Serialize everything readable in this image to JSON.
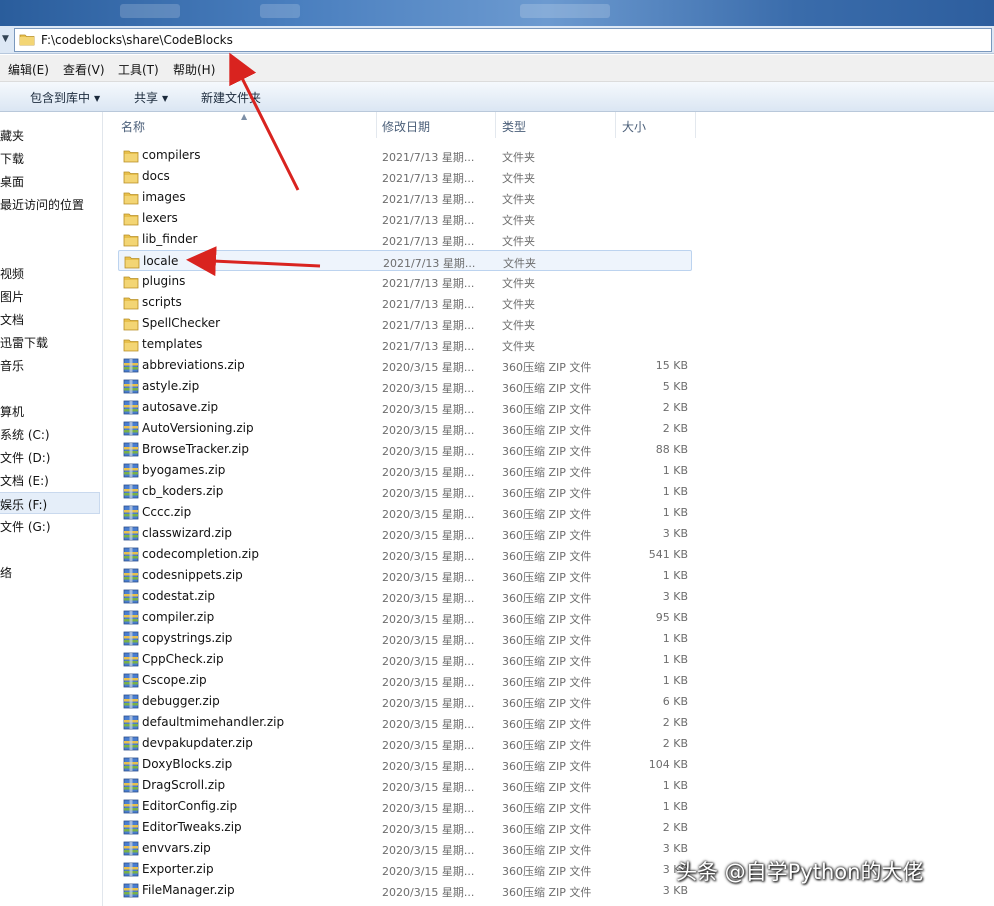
{
  "address": {
    "path": "F:\\codeblocks\\share\\CodeBlocks"
  },
  "menu": [
    "编辑(E)",
    "查看(V)",
    "工具(T)",
    "帮助(H)"
  ],
  "toolbar": {
    "include_label": "包含到库中",
    "share_label": "共享",
    "new_folder_label": "新建文件夹"
  },
  "sidebar": [
    "藏夹",
    "下载",
    "桌面",
    "最近访问的位置",
    "视频",
    "图片",
    "文档",
    "迅雷下载",
    "音乐",
    "算机",
    "系统 (C:)",
    "文件 (D:)",
    "文档 (E:)",
    "娱乐 (F:)",
    "文件 (G:)",
    "络"
  ],
  "columns": {
    "name": "名称",
    "date": "修改日期",
    "type": "类型",
    "size": "大小"
  },
  "files": [
    {
      "name": "compilers",
      "date": "2021/7/13 星期...",
      "type": "文件夹",
      "size": "",
      "icon": "folder-icon"
    },
    {
      "name": "docs",
      "date": "2021/7/13 星期...",
      "type": "文件夹",
      "size": "",
      "icon": "folder-icon"
    },
    {
      "name": "images",
      "date": "2021/7/13 星期...",
      "type": "文件夹",
      "size": "",
      "icon": "folder-icon"
    },
    {
      "name": "lexers",
      "date": "2021/7/13 星期...",
      "type": "文件夹",
      "size": "",
      "icon": "folder-icon"
    },
    {
      "name": "lib_finder",
      "date": "2021/7/13 星期...",
      "type": "文件夹",
      "size": "",
      "icon": "folder-icon"
    },
    {
      "name": "locale",
      "date": "2021/7/13 星期...",
      "type": "文件夹",
      "size": "",
      "icon": "folder-icon"
    },
    {
      "name": "plugins",
      "date": "2021/7/13 星期...",
      "type": "文件夹",
      "size": "",
      "icon": "folder-icon"
    },
    {
      "name": "scripts",
      "date": "2021/7/13 星期...",
      "type": "文件夹",
      "size": "",
      "icon": "folder-icon"
    },
    {
      "name": "SpellChecker",
      "date": "2021/7/13 星期...",
      "type": "文件夹",
      "size": "",
      "icon": "folder-icon"
    },
    {
      "name": "templates",
      "date": "2021/7/13 星期...",
      "type": "文件夹",
      "size": "",
      "icon": "folder-icon"
    },
    {
      "name": "abbreviations.zip",
      "date": "2020/3/15 星期...",
      "type": "360压缩 ZIP 文件",
      "size": "15 KB",
      "icon": "zip-archive-icon"
    },
    {
      "name": "astyle.zip",
      "date": "2020/3/15 星期...",
      "type": "360压缩 ZIP 文件",
      "size": "5 KB",
      "icon": "zip-archive-icon"
    },
    {
      "name": "autosave.zip",
      "date": "2020/3/15 星期...",
      "type": "360压缩 ZIP 文件",
      "size": "2 KB",
      "icon": "zip-archive-icon"
    },
    {
      "name": "AutoVersioning.zip",
      "date": "2020/3/15 星期...",
      "type": "360压缩 ZIP 文件",
      "size": "2 KB",
      "icon": "zip-archive-icon"
    },
    {
      "name": "BrowseTracker.zip",
      "date": "2020/3/15 星期...",
      "type": "360压缩 ZIP 文件",
      "size": "88 KB",
      "icon": "zip-archive-icon"
    },
    {
      "name": "byogames.zip",
      "date": "2020/3/15 星期...",
      "type": "360压缩 ZIP 文件",
      "size": "1 KB",
      "icon": "zip-archive-icon"
    },
    {
      "name": "cb_koders.zip",
      "date": "2020/3/15 星期...",
      "type": "360压缩 ZIP 文件",
      "size": "1 KB",
      "icon": "zip-archive-icon"
    },
    {
      "name": "Cccc.zip",
      "date": "2020/3/15 星期...",
      "type": "360压缩 ZIP 文件",
      "size": "1 KB",
      "icon": "zip-archive-icon"
    },
    {
      "name": "classwizard.zip",
      "date": "2020/3/15 星期...",
      "type": "360压缩 ZIP 文件",
      "size": "3 KB",
      "icon": "zip-archive-icon"
    },
    {
      "name": "codecompletion.zip",
      "date": "2020/3/15 星期...",
      "type": "360压缩 ZIP 文件",
      "size": "541 KB",
      "icon": "zip-archive-icon"
    },
    {
      "name": "codesnippets.zip",
      "date": "2020/3/15 星期...",
      "type": "360压缩 ZIP 文件",
      "size": "1 KB",
      "icon": "zip-archive-icon"
    },
    {
      "name": "codestat.zip",
      "date": "2020/3/15 星期...",
      "type": "360压缩 ZIP 文件",
      "size": "3 KB",
      "icon": "zip-archive-icon"
    },
    {
      "name": "compiler.zip",
      "date": "2020/3/15 星期...",
      "type": "360压缩 ZIP 文件",
      "size": "95 KB",
      "icon": "zip-archive-icon"
    },
    {
      "name": "copystrings.zip",
      "date": "2020/3/15 星期...",
      "type": "360压缩 ZIP 文件",
      "size": "1 KB",
      "icon": "zip-archive-icon"
    },
    {
      "name": "CppCheck.zip",
      "date": "2020/3/15 星期...",
      "type": "360压缩 ZIP 文件",
      "size": "1 KB",
      "icon": "zip-archive-icon"
    },
    {
      "name": "Cscope.zip",
      "date": "2020/3/15 星期...",
      "type": "360压缩 ZIP 文件",
      "size": "1 KB",
      "icon": "zip-archive-icon"
    },
    {
      "name": "debugger.zip",
      "date": "2020/3/15 星期...",
      "type": "360压缩 ZIP 文件",
      "size": "6 KB",
      "icon": "zip-archive-icon"
    },
    {
      "name": "defaultmimehandler.zip",
      "date": "2020/3/15 星期...",
      "type": "360压缩 ZIP 文件",
      "size": "2 KB",
      "icon": "zip-archive-icon"
    },
    {
      "name": "devpakupdater.zip",
      "date": "2020/3/15 星期...",
      "type": "360压缩 ZIP 文件",
      "size": "2 KB",
      "icon": "zip-archive-icon"
    },
    {
      "name": "DoxyBlocks.zip",
      "date": "2020/3/15 星期...",
      "type": "360压缩 ZIP 文件",
      "size": "104 KB",
      "icon": "zip-archive-icon"
    },
    {
      "name": "DragScroll.zip",
      "date": "2020/3/15 星期...",
      "type": "360压缩 ZIP 文件",
      "size": "1 KB",
      "icon": "zip-archive-icon"
    },
    {
      "name": "EditorConfig.zip",
      "date": "2020/3/15 星期...",
      "type": "360压缩 ZIP 文件",
      "size": "1 KB",
      "icon": "zip-archive-icon"
    },
    {
      "name": "EditorTweaks.zip",
      "date": "2020/3/15 星期...",
      "type": "360压缩 ZIP 文件",
      "size": "2 KB",
      "icon": "zip-archive-icon"
    },
    {
      "name": "envvars.zip",
      "date": "2020/3/15 星期...",
      "type": "360压缩 ZIP 文件",
      "size": "3 KB",
      "icon": "zip-archive-icon"
    },
    {
      "name": "Exporter.zip",
      "date": "2020/3/15 星期...",
      "type": "360压缩 ZIP 文件",
      "size": "3 KB",
      "icon": "zip-archive-icon"
    },
    {
      "name": "FileManager.zip",
      "date": "2020/3/15 星期...",
      "type": "360压缩 ZIP 文件",
      "size": "3 KB",
      "icon": "zip-archive-icon"
    }
  ],
  "highlighted_file": "locale",
  "watermark": "头条 @自学Python的大佬",
  "colors": {
    "arrow": "#d9231f",
    "folder": "#e8c04c",
    "highlight": "#eef4fc"
  }
}
